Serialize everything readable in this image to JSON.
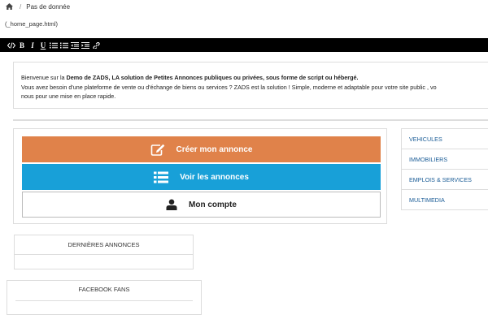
{
  "breadcrumb": {
    "separator": "/",
    "current": "Pas de donnée"
  },
  "filename": "(_home_page.html)",
  "toolbar": {
    "bold": "B",
    "italic": "I",
    "underline": "U"
  },
  "welcome": {
    "line1_pre": "Bienvenue sur la ",
    "line1_bold": "Demo de ZADS, LA solution de Petites Annonces publiques ou privées, sous forme de script ou hébergé.",
    "line2": "Vous avez besoin d'une plateforme de vente ou d'échange de biens ou services ? ZADS est la solution ! Simple, moderne et adaptable pour votre site public , vo",
    "line3": "nous pour une mise en place rapide."
  },
  "actions": {
    "create": "Créer mon annonce",
    "list": "Voir les annonces",
    "account": "Mon compte"
  },
  "categories": [
    "VEHICULES",
    "IMMOBILIERS",
    "EMPLOIS & SERVICES",
    "MULTIMEDIA"
  ],
  "panels": {
    "latest": "DERNIÈRES ANNONCES",
    "facebook": "FACEBOOK FANS"
  },
  "colors": {
    "create": "#e0824a",
    "list": "#18a0d8",
    "link": "#1a5c96",
    "toolbar": "#000000"
  }
}
